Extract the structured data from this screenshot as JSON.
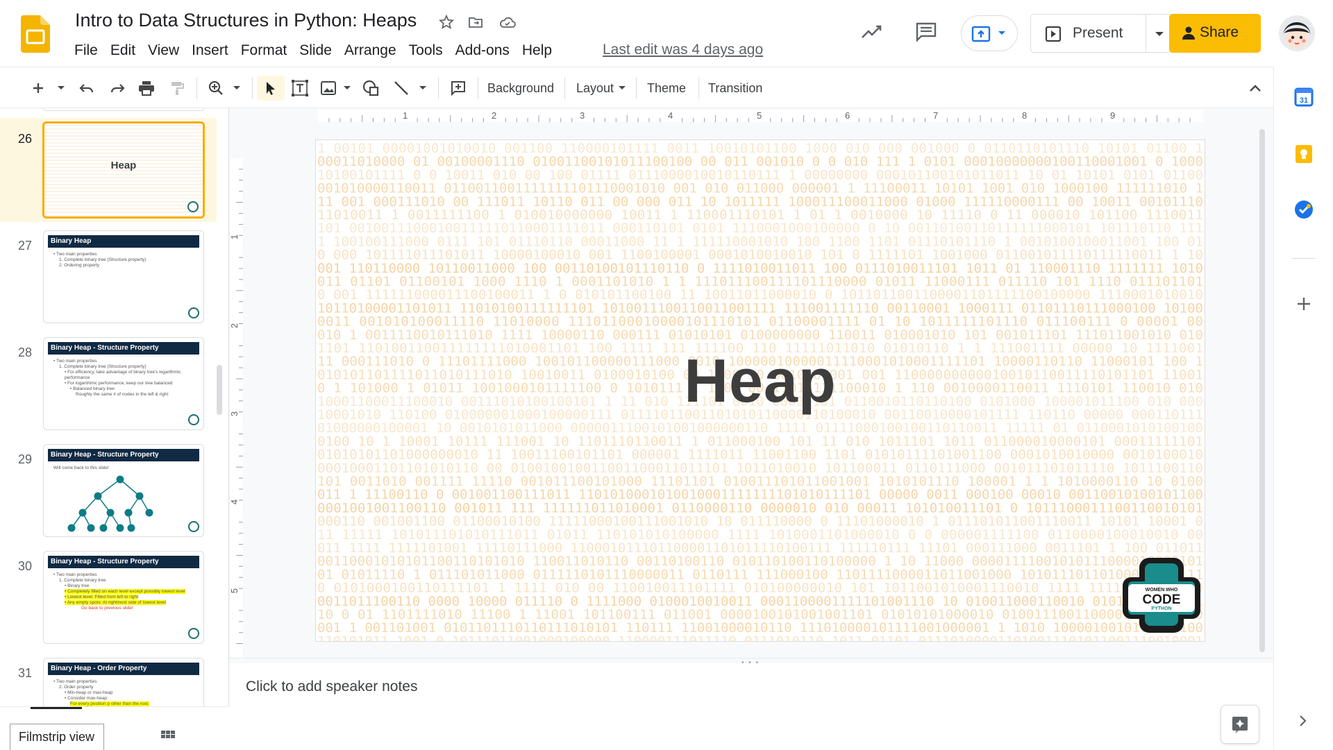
{
  "app": {
    "title": "Intro to Data Structures in Python: Heaps",
    "last_edit": "Last edit was 4 days ago",
    "brand_color": "#fbbc04"
  },
  "menu": [
    "File",
    "Edit",
    "View",
    "Insert",
    "Format",
    "Slide",
    "Arrange",
    "Tools",
    "Add-ons",
    "Help"
  ],
  "header_actions": {
    "present_label": "Present",
    "share_label": "Share"
  },
  "toolbar": {
    "background_label": "Background",
    "layout_label": "Layout",
    "theme_label": "Theme",
    "transition_label": "Transition"
  },
  "ruler": {
    "horizontal": [
      "1",
      "2",
      "3",
      "4",
      "5",
      "6",
      "7",
      "8",
      "9"
    ],
    "vertical": [
      "1",
      "2",
      "3",
      "4",
      "5"
    ]
  },
  "slides": [
    {
      "number": "26",
      "active": true,
      "kind": "title",
      "title": "Heap"
    },
    {
      "number": "27",
      "active": false,
      "kind": "content",
      "title": "Binary Heap",
      "lines": [
        "• Two main properties",
        "1. Complete binary tree (Structure property)",
        "2. Ordering property"
      ]
    },
    {
      "number": "28",
      "active": false,
      "kind": "content",
      "title": "Binary Heap - Structure Property",
      "lines": [
        "• Two main properties",
        "1. Complete binary tree (Structure property)",
        "• For efficiency, take advantage of binary tree's logarithmic performance",
        "• For logarithmic performance, keep our tree balanced",
        "• Balanced binary tree:",
        "Roughly the same # of nodes in the left & right"
      ]
    },
    {
      "number": "29",
      "active": false,
      "kind": "tree",
      "title": "Binary Heap - Structure Property",
      "lines": [
        "Will come back to this slide!"
      ]
    },
    {
      "number": "30",
      "active": false,
      "kind": "content",
      "title": "Binary Heap - Structure Property",
      "lines": [
        "• Two main properties",
        "1. Complete binary tree",
        "• Binary tree",
        "• Completely filled on each level except possibly lowest level",
        "• Lowest level: Filled from left to right",
        "• Any empty spots: At rightmost side of lowest level",
        "Go back to previous slide!"
      ]
    },
    {
      "number": "31",
      "active": false,
      "kind": "content",
      "title": "Binary Heap - Order Property",
      "lines": [
        "• Two main properties",
        "2. Order property",
        "• Min-heap or max-heap",
        "• Consider max-heap:",
        "For every position p other than the root,"
      ]
    }
  ],
  "filmstrip_footer": {
    "filmstrip_view_label": "Filmstrip view"
  },
  "current_slide": {
    "title": "Heap",
    "logo_text": [
      "WOMEN WHO",
      "CODE",
      "PYTHON"
    ],
    "background_digit_color": "#f5cf9a"
  },
  "notes": {
    "placeholder": "Click to add speaker notes"
  },
  "side_panel": [
    "calendar-icon",
    "keep-icon",
    "tasks-icon",
    "add-icon"
  ]
}
